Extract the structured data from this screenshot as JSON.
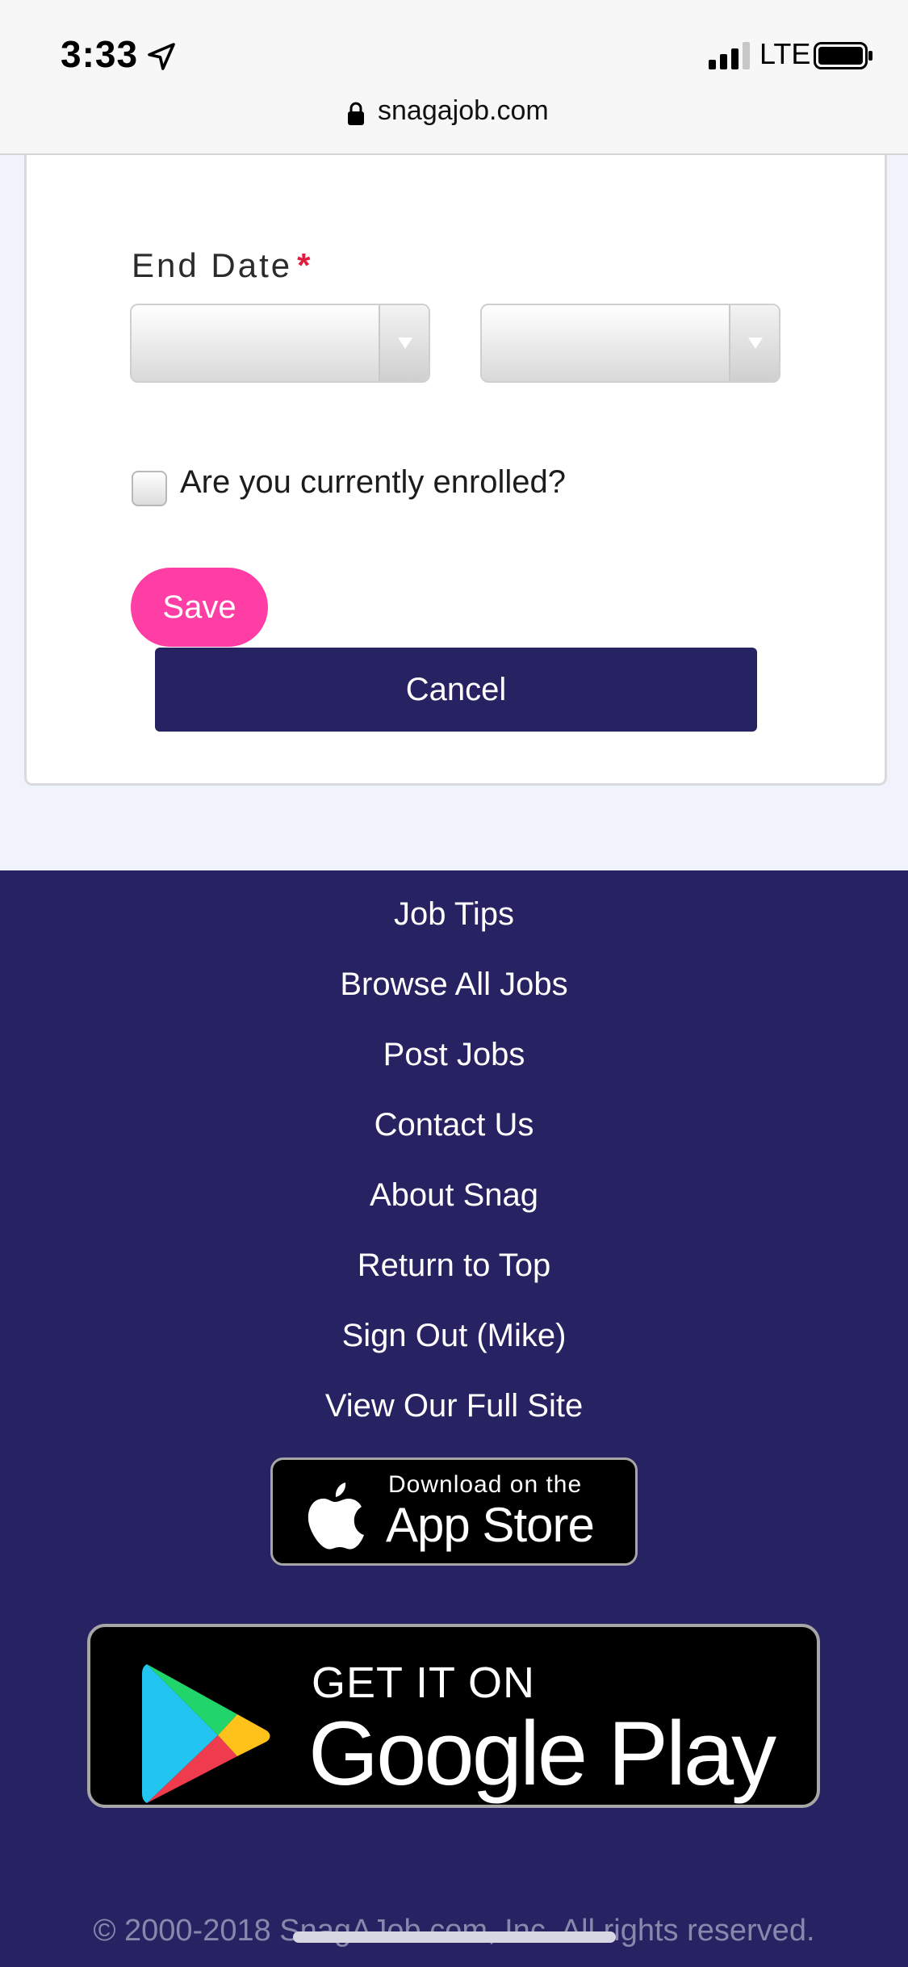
{
  "status_bar": {
    "time": "3:33",
    "network": "LTE",
    "icons": [
      "location-arrow-icon",
      "signal-bars-icon",
      "battery-icon"
    ]
  },
  "browser": {
    "url": "snagajob.com",
    "lock_icon": "lock-icon"
  },
  "form": {
    "end_date_label": "End Date",
    "required_marker": "*",
    "end_date_month_value": "",
    "end_date_year_value": "",
    "enrolled_label": "Are you currently enrolled?",
    "enrolled_checked": false,
    "save_label": "Save",
    "cancel_label": "Cancel"
  },
  "footer": {
    "links": [
      "Job Tips",
      "Browse All Jobs",
      "Post Jobs",
      "Contact Us",
      "About Snag",
      "Return to Top",
      "Sign Out (Mike)",
      "View Our Full Site"
    ],
    "app_store": {
      "small": "Download on the",
      "big": "App Store"
    },
    "google_play": {
      "small": "GET IT ON",
      "big": "Google Play"
    },
    "copyright": "© 2000-2018 SnagAJob.com, Inc. All rights reserved."
  },
  "colors": {
    "brand_navy": "#272261",
    "save_pink": "#ff3ea5",
    "required_red": "#e31b3d",
    "page_bg": "#f1f3fc"
  }
}
